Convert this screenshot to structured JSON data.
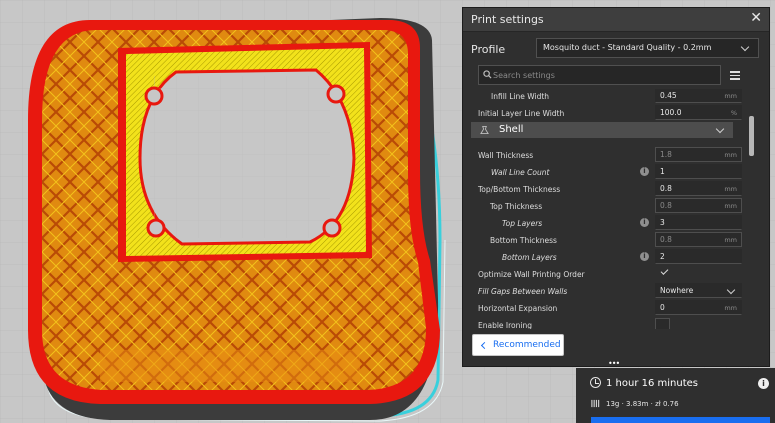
{
  "panel": {
    "title": "Print settings",
    "profile_label": "Profile",
    "profile_value": "Mosquito duct - Standard Quality - 0.2mm",
    "search_placeholder": "Search settings",
    "recommended_label": "Recommended"
  },
  "settings": {
    "infill_line_width": {
      "label": "Infill Line Width",
      "value": "0.45",
      "unit": "mm"
    },
    "initial_layer_line_width": {
      "label": "Initial Layer Line Width",
      "value": "100.0",
      "unit": "%"
    },
    "shell_label": "Shell",
    "wall_thickness": {
      "label": "Wall Thickness",
      "value": "1.8",
      "unit": "mm"
    },
    "wall_line_count": {
      "label": "Wall Line Count",
      "value": "1"
    },
    "top_bottom_thickness": {
      "label": "Top/Bottom Thickness",
      "value": "0.8",
      "unit": "mm"
    },
    "top_thickness": {
      "label": "Top Thickness",
      "value": "0.8",
      "unit": "mm"
    },
    "top_layers": {
      "label": "Top Layers",
      "value": "3"
    },
    "bottom_thickness": {
      "label": "Bottom Thickness",
      "value": "0.8",
      "unit": "mm"
    },
    "bottom_layers": {
      "label": "Bottom Layers",
      "value": "2"
    },
    "optimize_wall_order": {
      "label": "Optimize Wall Printing Order",
      "checked": true
    },
    "fill_gaps": {
      "label": "Fill Gaps Between Walls",
      "value": "Nowhere"
    },
    "horizontal_expansion": {
      "label": "Horizontal Expansion",
      "value": "0",
      "unit": "mm"
    },
    "enable_ironing": {
      "label": "Enable Ironing",
      "checked": false
    }
  },
  "print_info": {
    "time": "1 hour 16 minutes",
    "material": "13g · 3.83m · zł 0.76"
  },
  "colors": {
    "accent": "#196ef0",
    "panel_bg": "#2f2f2f",
    "model_red": "#e8180f",
    "model_orange": "#e5981a",
    "model_yellow": "#f2e21b",
    "skirt_cyan": "#39d0dc"
  }
}
